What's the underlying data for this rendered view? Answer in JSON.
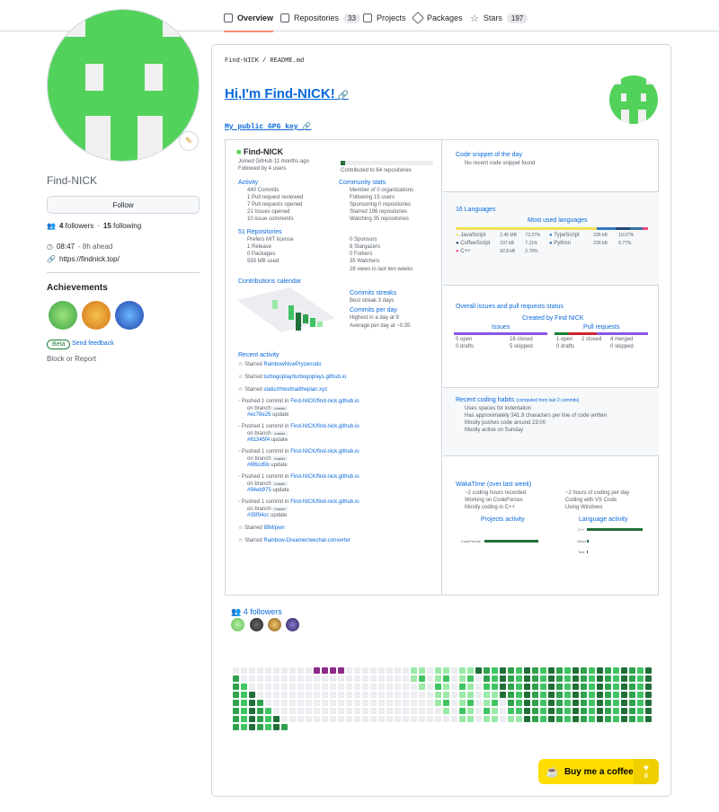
{
  "nav": {
    "tabs": [
      {
        "label": "Overview",
        "icon": "book-icon"
      },
      {
        "label": "Repositories",
        "count": "33",
        "icon": "repo-icon"
      },
      {
        "label": "Projects",
        "icon": "table-icon"
      },
      {
        "label": "Packages",
        "icon": "package-icon"
      },
      {
        "label": "Stars",
        "count": "197",
        "icon": "star-icon"
      }
    ]
  },
  "profile": {
    "name": "Find-NICK",
    "follow": "Follow",
    "followers": "4",
    "followers_label": "followers",
    "following": "15",
    "following_label": "following",
    "time": "08:47",
    "time_note": "- 8h ahead",
    "link": "https://findnick.top/",
    "achievements_title": "Achievements",
    "beta": "Beta",
    "feedback": "Send feedback",
    "block": "Block or Report"
  },
  "readme": {
    "crumb_user": "Find-NICK",
    "crumb_sep": "/",
    "crumb_file": "README.md",
    "title": "Hi,I'm Find-NICK!",
    "gpg": "My public GPG key"
  },
  "metrics": {
    "user": "Find-NICK",
    "joined": "Joined GitHub 11 months ago",
    "followed": "Followed by 4 users",
    "contributed": "Contributed to 64 repositories",
    "activity": "Activity",
    "act": [
      "440 Commits",
      "1 Pull request reviewed",
      "7 Pull requests opened",
      "21 Issues opened",
      "10 issue comments"
    ],
    "community": "Community stats",
    "com": [
      "Member of 0 organizations",
      "Following 15 users",
      "Sponsoring 0 repositories",
      "Starred 196 repositories",
      "Watching 35 repositories"
    ],
    "repos": "51 Repositories",
    "rep": [
      "Prefers MIT license",
      "1 Release",
      "0 Packages",
      "593 MB used"
    ],
    "rep2": [
      "0 Sponsors",
      "8 Stargazers",
      "0 Forkers",
      "35 Watchers",
      "28 views in last two weeks"
    ],
    "calendar": "Contributions calendar",
    "streaks": "Commits streaks",
    "best": "Best streak 3 days",
    "perday": "Commits per day",
    "highest": "Highest in a day at 9",
    "average": "Average per day at ~0.35",
    "recent": "Recent activity",
    "events": [
      {
        "t": "Starred",
        "r": "RainbowNowPryzenodo"
      },
      {
        "t": "Starred",
        "r": "turbogoplay/turbogoplays.github.io"
      },
      {
        "t": "Starred",
        "r": "static/rhtesttrailtheplan.xyz"
      },
      {
        "t": "Pushed 1 commit in",
        "r": "Find-NICK/find-nick.github.io",
        "b": "on branch",
        "br": "master",
        "h": "#ec78e25",
        "u": "update"
      },
      {
        "t": "Pushed 1 commit in",
        "r": "Find-NICK/find-nick.github.io",
        "b": "on branch",
        "br": "master",
        "h": "#81345f4",
        "u": "update"
      },
      {
        "t": "Pushed 1 commit in",
        "r": "Find-NICK/find-nick.github.io",
        "b": "on branch",
        "br": "master",
        "h": "#6f6cd5b",
        "u": "update"
      },
      {
        "t": "Pushed 1 commit in",
        "r": "Find-NICK/find-nick.github.io",
        "b": "on branch",
        "br": "master",
        "h": "#94eb975",
        "u": "update"
      },
      {
        "t": "Pushed 1 commit in",
        "r": "Find-NICK/find-nick.github.io",
        "b": "on branch",
        "br": "master",
        "h": "#35f94cc",
        "u": "update"
      },
      {
        "t": "Starred",
        "r": "IBM/pwn"
      },
      {
        "t": "Starred",
        "r": "Rainbow-Dreamer/wechat-converter"
      }
    ],
    "snippet": "Code snippet of the day",
    "snippet_none": "No recent code snippet found",
    "languages": "16 Languages",
    "mostused": "Most used languages",
    "langs": [
      {
        "name": "JavaScript",
        "size": "2.45 MB",
        "pct": "73.27%",
        "color": "#f1e05a"
      },
      {
        "name": "TypeScript",
        "size": "336 kB",
        "pct": "10.07%",
        "color": "#3178c6"
      },
      {
        "name": "CoffeeScript",
        "size": "237 kB",
        "pct": "7.11%",
        "color": "#244776"
      },
      {
        "name": "Python",
        "size": "226 kB",
        "pct": "6.77%",
        "color": "#3572A5"
      },
      {
        "name": "C++",
        "size": "92.8 kB",
        "pct": "2.78%",
        "color": "#f34b7d"
      }
    ],
    "issues_title": "Overall issues and pull requests status",
    "created": "Created by Find NICK",
    "issues": "Issues",
    "prs": "Pull requests",
    "istat": [
      "0 open",
      "16 closed",
      "0 drafts",
      "5 skipped"
    ],
    "pstat": [
      "1 open",
      "2 closed",
      "4 merged",
      "0 drafts",
      "0 skipped"
    ],
    "habits": "Recent coding habits",
    "habits_note": "(computed from last 2 commits)",
    "hab": [
      "Uses spaces for indentation",
      "Has approximately 341.9 characters per line of code written",
      "Mostly pushes code around 23:00",
      "Mostly active on Sunday"
    ],
    "waka": "WakaTime (over last week)",
    "wk": [
      "~2 coding hours recorded",
      "~2 hours of coding per day",
      "Working on CodeForces",
      "Coding with VS Code",
      "Mostly coding in C++",
      "Using Windows"
    ],
    "projects": "Projects activity",
    "language_activity": "Language activity",
    "proj_name": "CodeForces",
    "lang_names": [
      "C++",
      "Other",
      "Text"
    ]
  },
  "followers_title": "4 followers",
  "bmc": "Buy me a coffee",
  "bmc_count": "0"
}
